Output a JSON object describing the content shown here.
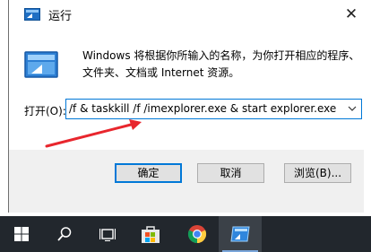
{
  "dialog": {
    "title": "运行",
    "close_glyph": "✕",
    "description": "Windows 将根据你所输入的名称，为你打开相应的程序、文件夹、文档或 Internet 资源。",
    "open_label": "打开(O):",
    "command_value": "/f & taskkill /f /imexplorer.exe & start explorer.exe",
    "buttons": {
      "ok": "确定",
      "cancel": "取消",
      "browse": "浏览(B)..."
    },
    "accent_color": "#0078d7"
  },
  "annotation": {
    "arrow_color": "#e8262d"
  },
  "taskbar": {
    "background": "#22272d",
    "items": [
      {
        "icon": "windows-start-icon"
      },
      {
        "icon": "search-icon"
      },
      {
        "icon": "task-view-icon"
      },
      {
        "icon": "store-icon"
      },
      {
        "icon": "chrome-icon"
      },
      {
        "icon": "run-app-icon"
      }
    ]
  }
}
